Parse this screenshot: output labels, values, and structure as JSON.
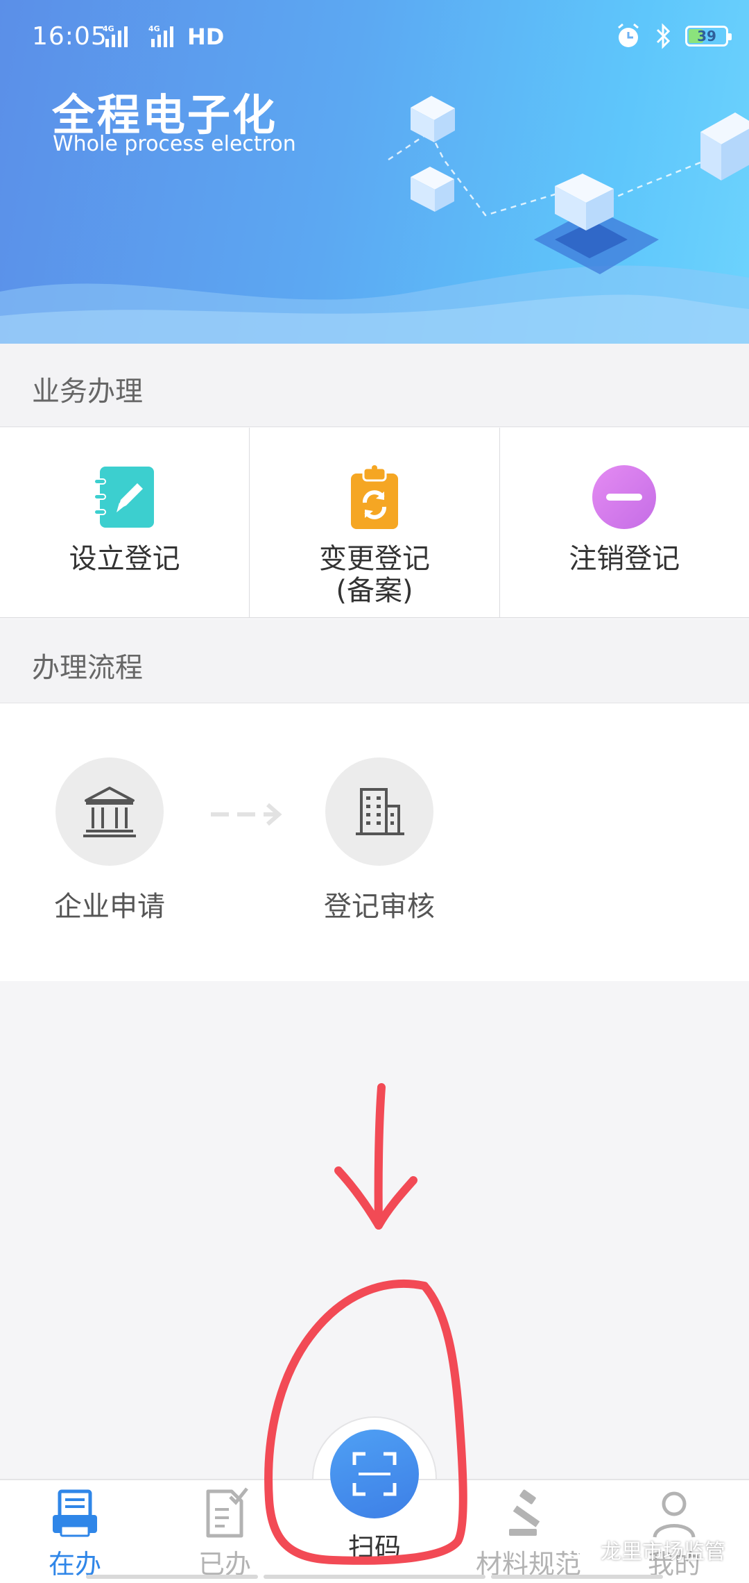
{
  "status_bar": {
    "time": "16:05",
    "network_1": "4G",
    "network_2": "4G",
    "hd_label": "HD",
    "battery_level": "39"
  },
  "banner": {
    "title": "全程电子化",
    "subtitle": "Whole process electron"
  },
  "sections": {
    "business": "业务办理",
    "process": "办理流程"
  },
  "business_items": [
    {
      "label": "设立登记",
      "icon": "notebook-edit-icon",
      "color": "#3ccfcf"
    },
    {
      "label_line1": "变更登记",
      "label_line2": "(备案)",
      "icon": "clipboard-refresh-icon",
      "color": "#f5a623"
    },
    {
      "label": "注销登记",
      "icon": "minus-circle-icon",
      "color": "#d67ff0"
    }
  ],
  "process_steps": [
    {
      "label": "企业申请",
      "icon": "bank-building-icon"
    },
    {
      "label": "登记审核",
      "icon": "office-building-icon"
    }
  ],
  "tabs": [
    {
      "label": "在办",
      "icon": "printer-list-icon",
      "active": true
    },
    {
      "label": "已办",
      "icon": "document-check-icon",
      "active": false
    },
    {
      "label": "扫码",
      "icon": "scan-icon",
      "active": false
    },
    {
      "label": "材料规范",
      "icon": "gavel-icon",
      "active": false
    },
    {
      "label": "我的",
      "icon": "person-icon",
      "active": false
    }
  ],
  "watermark": "龙里市场监管",
  "colors": {
    "accent": "#2f86e8",
    "annotation": "#f24a55"
  }
}
